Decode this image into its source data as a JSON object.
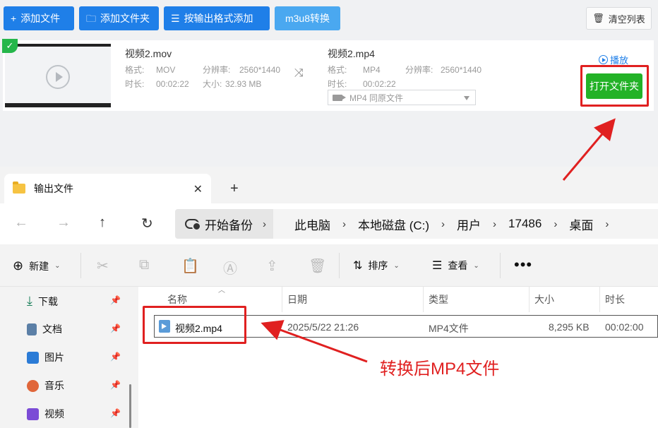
{
  "converter": {
    "toolbar": {
      "add_file": "添加文件",
      "add_folder": "添加文件夹",
      "add_by_format": "按输出格式添加",
      "m3u8": "m3u8转换",
      "clear_list": "清空列表"
    },
    "file": {
      "source_name": "视频2.mov",
      "source_format_label": "格式:",
      "source_format": "MOV",
      "source_res_label": "分辨率:",
      "source_res": "2560*1440",
      "source_dur_label": "时长:",
      "source_dur": "00:02:22",
      "source_size_label": "大小:",
      "source_size": "32.93 MB",
      "output_name": "视频2.mp4",
      "output_format_label": "格式:",
      "output_format": "MP4",
      "output_res_label": "分辨率:",
      "output_res": "2560*1440",
      "output_dur_label": "时长:",
      "output_dur": "00:02:22",
      "format_select": "MP4   同原文件",
      "play": "播放",
      "open_folder": "打开文件夹"
    }
  },
  "explorer": {
    "tab_title": "输出文件",
    "breadcrumb": {
      "backup": "开始备份",
      "items": [
        "此电脑",
        "本地磁盘 (C:)",
        "用户",
        "17486",
        "桌面"
      ]
    },
    "commands": {
      "new": "新建",
      "sort": "排序",
      "view": "查看",
      "more": "•••"
    },
    "sidebar": [
      {
        "label": "下载",
        "icon": "download-icon",
        "color": "#1a7f5a"
      },
      {
        "label": "文档",
        "icon": "document-icon",
        "color": "#5b7fa6"
      },
      {
        "label": "图片",
        "icon": "pictures-icon",
        "color": "#2b7bd6"
      },
      {
        "label": "音乐",
        "icon": "music-icon",
        "color": "#e0663a"
      },
      {
        "label": "视频",
        "icon": "videos-icon",
        "color": "#7b4bd6"
      }
    ],
    "columns": [
      "名称",
      "日期",
      "类型",
      "大小",
      "时长"
    ],
    "rows": [
      {
        "name": "视频2.mp4",
        "date": "2025/5/22 21:26",
        "type": "MP4文件",
        "size": "8,295 KB",
        "duration": "00:02:00"
      }
    ]
  },
  "annotation": {
    "text": "转换后MP4文件",
    "color": "#e02020"
  }
}
